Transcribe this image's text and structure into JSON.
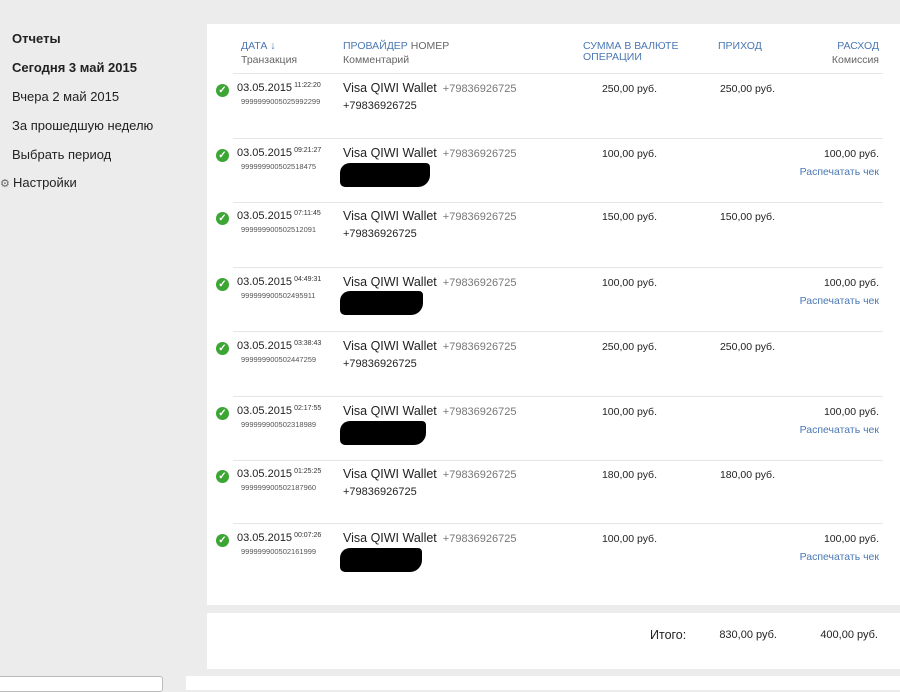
{
  "sidebar": {
    "items": [
      {
        "label": "Отчеты",
        "bold": true
      },
      {
        "label": "Сегодня 3 май 2015",
        "bold": true
      },
      {
        "label": "Вчера 2 май 2015",
        "bold": false
      },
      {
        "label": "За прошедшую неделю",
        "bold": false
      },
      {
        "label": "Выбрать период",
        "bold": false
      }
    ],
    "settings_label": "Настройки"
  },
  "table": {
    "headers": {
      "date": "ДАТА ↓",
      "transaction": "Транзакция",
      "provider": "ПРОВАЙДЕР",
      "number": "НОМЕР",
      "comment": "Комментарий",
      "op_amount_l1": "СУММА В ВАЛЮТЕ",
      "op_amount_l2": "ОПЕРАЦИИ",
      "income": "ПРИХОД",
      "expense": "РАСХОД",
      "commission": "Комиссия"
    },
    "rows": [
      {
        "date": "03.05.2015",
        "time": "11:22:20",
        "txn": "9999999005025992299",
        "provider": "Visa QIWI Wallet",
        "number": "+79836926725",
        "comment": "+79836926725",
        "amount": "250,00 руб.",
        "income": "250,00 руб.",
        "expense": "",
        "print": ""
      },
      {
        "date": "03.05.2015",
        "time": "09:21:27",
        "txn": "999999900502518475",
        "provider": "Visa QIWI Wallet",
        "number": "+79836926725",
        "comment": "",
        "amount": "100,00 руб.",
        "income": "",
        "expense": "100,00 руб.",
        "print": "Распечатать чек"
      },
      {
        "date": "03.05.2015",
        "time": "07:11:45",
        "txn": "999999900502512091",
        "provider": "Visa QIWI Wallet",
        "number": "+79836926725",
        "comment": "+79836926725",
        "amount": "150,00 руб.",
        "income": "150,00 руб.",
        "expense": "",
        "print": ""
      },
      {
        "date": "03.05.2015",
        "time": "04:49:31",
        "txn": "999999900502495911",
        "provider": "Visa QIWI Wallet",
        "number": "+79836926725",
        "comment": "",
        "amount": "100,00 руб.",
        "income": "",
        "expense": "100,00 руб.",
        "print": "Распечатать чек"
      },
      {
        "date": "03.05.2015",
        "time": "03:38:43",
        "txn": "999999900502447259",
        "provider": "Visa QIWI Wallet",
        "number": "+79836926725",
        "comment": "+79836926725",
        "amount": "250,00 руб.",
        "income": "250,00 руб.",
        "expense": "",
        "print": ""
      },
      {
        "date": "03.05.2015",
        "time": "02:17:55",
        "txn": "999999900502318989",
        "provider": "Visa QIWI Wallet",
        "number": "+79836926725",
        "comment": "",
        "amount": "100,00 руб.",
        "income": "",
        "expense": "100,00 руб.",
        "print": "Распечатать чек"
      },
      {
        "date": "03.05.2015",
        "time": "01:25:25",
        "txn": "999999900502187960",
        "provider": "Visa QIWI Wallet",
        "number": "+79836926725",
        "comment": "+79836926725",
        "amount": "180,00 руб.",
        "income": "180,00 руб.",
        "expense": "",
        "print": ""
      },
      {
        "date": "03.05.2015",
        "time": "00:07:26",
        "txn": "999999900502161999",
        "provider": "Visa QIWI Wallet",
        "number": "+79836926725",
        "comment": "",
        "amount": "100,00 руб.",
        "income": "",
        "expense": "100,00 руб.",
        "print": "Распечатать чек"
      }
    ]
  },
  "totals": {
    "label": "Итого:",
    "income": "830,00 руб.",
    "expense": "400,00 руб."
  },
  "colors": {
    "accent": "#4a78b3",
    "success": "#3ca534"
  },
  "icons": {
    "status": "check-circle-icon",
    "settings": "gear-icon"
  }
}
